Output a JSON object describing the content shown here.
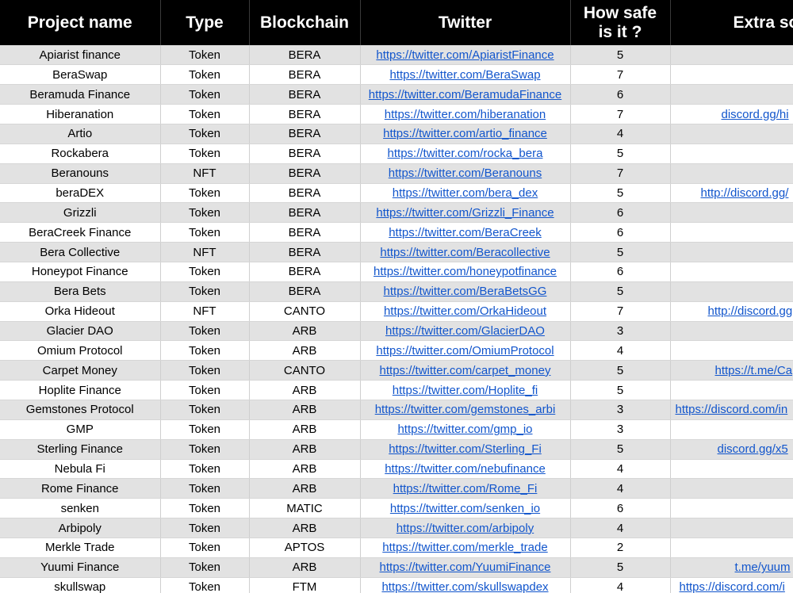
{
  "headers": {
    "project": "Project name",
    "type": "Type",
    "blockchain": "Blockchain",
    "twitter": "Twitter",
    "safety_line1": "How safe",
    "safety_line2": "is it ?",
    "extra": "Extra so"
  },
  "colors": {
    "header_bg": "#000000",
    "row_shade": "#e2e2e2",
    "link": "#1155cc"
  },
  "rows": [
    {
      "name": "Apiarist finance",
      "type": "Token",
      "chain": "BERA",
      "twitter": "https://twitter.com/ApiaristFinance",
      "safety": "5",
      "extra": ""
    },
    {
      "name": "BeraSwap",
      "type": "Token",
      "chain": "BERA",
      "twitter": "https://twitter.com/BeraSwap",
      "safety": "7",
      "extra": ""
    },
    {
      "name": "Beramuda Finance",
      "type": "Token",
      "chain": "BERA",
      "twitter": "https://twitter.com/BeramudaFinance",
      "safety": "6",
      "extra": ""
    },
    {
      "name": "Hiberanation",
      "type": "Token",
      "chain": "BERA",
      "twitter": "https://twitter.com/hiberanation",
      "safety": "7",
      "extra": "discord.gg/hi"
    },
    {
      "name": "Artio",
      "type": "Token",
      "chain": "BERA",
      "twitter": "https://twitter.com/artio_finance",
      "safety": "4",
      "extra": ""
    },
    {
      "name": "Rockabera",
      "type": "Token",
      "chain": "BERA",
      "twitter": "https://twitter.com/rocka_bera",
      "safety": "5",
      "extra": ""
    },
    {
      "name": "Beranouns",
      "type": "NFT",
      "chain": "BERA",
      "twitter": "https://twitter.com/Beranouns",
      "safety": "7",
      "extra": ""
    },
    {
      "name": "beraDEX",
      "type": "Token",
      "chain": "BERA",
      "twitter": "https://twitter.com/bera_dex",
      "safety": "5",
      "extra": "http://discord.gg/"
    },
    {
      "name": "Grizzli",
      "type": "Token",
      "chain": "BERA",
      "twitter": "https://twitter.com/Grizzli_Finance",
      "safety": "6",
      "extra": ""
    },
    {
      "name": "BeraCreek Finance",
      "type": "Token",
      "chain": "BERA",
      "twitter": "https://twitter.com/BeraCreek",
      "safety": "6",
      "extra": ""
    },
    {
      "name": "Bera Collective",
      "type": "NFT",
      "chain": "BERA",
      "twitter": "https://twitter.com/Beracollective",
      "safety": "5",
      "extra": ""
    },
    {
      "name": "Honeypot Finance",
      "type": "Token",
      "chain": "BERA",
      "twitter": "https://twitter.com/honeypotfinance",
      "safety": "6",
      "extra": ""
    },
    {
      "name": "Bera Bets",
      "type": "Token",
      "chain": "BERA",
      "twitter": "https://twitter.com/BeraBetsGG",
      "safety": "5",
      "extra": ""
    },
    {
      "name": "Orka Hideout",
      "type": "NFT",
      "chain": "CANTO",
      "twitter": "https://twitter.com/OrkaHideout",
      "safety": "7",
      "extra": "http://discord.gg"
    },
    {
      "name": "Glacier DAO",
      "type": "Token",
      "chain": "ARB",
      "twitter": "https://twitter.com/GlacierDAO",
      "safety": "3",
      "extra": ""
    },
    {
      "name": "Omium Protocol",
      "type": "Token",
      "chain": "ARB",
      "twitter": "https://twitter.com/OmiumProtocol",
      "safety": "4",
      "extra": ""
    },
    {
      "name": "Carpet Money",
      "type": "Token",
      "chain": "CANTO",
      "twitter": "https://twitter.com/carpet_money",
      "safety": "5",
      "extra": "https://t.me/Ca"
    },
    {
      "name": "Hoplite Finance",
      "type": "Token",
      "chain": "ARB",
      "twitter": "https://twitter.com/Hoplite_fi",
      "safety": "5",
      "extra": ""
    },
    {
      "name": "Gemstones Protocol",
      "type": "Token",
      "chain": "ARB",
      "twitter": "https://twitter.com/gemstones_arbi",
      "safety": "3",
      "extra": "https://discord.com/in"
    },
    {
      "name": "GMP",
      "type": "Token",
      "chain": "ARB",
      "twitter": "https://twitter.com/gmp_io",
      "safety": "3",
      "extra": ""
    },
    {
      "name": "Sterling Finance",
      "type": "Token",
      "chain": "ARB",
      "twitter": "https://twitter.com/Sterling_Fi",
      "safety": "5",
      "extra": "discord.gg/x5"
    },
    {
      "name": "Nebula Fi",
      "type": "Token",
      "chain": "ARB",
      "twitter": "https://twitter.com/nebufinance",
      "safety": "4",
      "extra": ""
    },
    {
      "name": "Rome Finance",
      "type": "Token",
      "chain": "ARB",
      "twitter": "https://twitter.com/Rome_Fi",
      "safety": "4",
      "extra": ""
    },
    {
      "name": "senken",
      "type": "Token",
      "chain": "MATIC",
      "twitter": "https://twitter.com/senken_io",
      "safety": "6",
      "extra": ""
    },
    {
      "name": "Arbipoly",
      "type": "Token",
      "chain": "ARB",
      "twitter": "https://twitter.com/arbipoly",
      "safety": "4",
      "extra": ""
    },
    {
      "name": "Merkle Trade",
      "type": "Token",
      "chain": "APTOS",
      "twitter": "https://twitter.com/merkle_trade",
      "safety": "2",
      "extra": ""
    },
    {
      "name": "Yuumi Finance",
      "type": "Token",
      "chain": "ARB",
      "twitter": "https://twitter.com/YuumiFinance",
      "safety": "5",
      "extra": "t.me/yuum"
    },
    {
      "name": "skullswap",
      "type": "Token",
      "chain": "FTM",
      "twitter": "https://twitter.com/skullswapdex",
      "safety": "4",
      "extra": "https://discord.com/i"
    }
  ]
}
